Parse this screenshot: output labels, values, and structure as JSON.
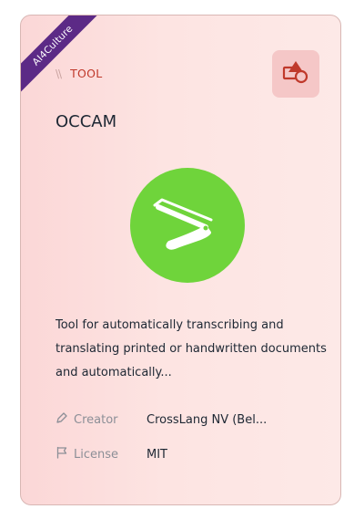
{
  "ribbon": {
    "label": "AI4Culture"
  },
  "category": {
    "separator": "\\\\",
    "label": "TOOL"
  },
  "type_icon": "shapes-icon",
  "title": "OCCAM",
  "logo": {
    "icon": "razor-icon",
    "bg_color": "#6fd43b"
  },
  "description": "Tool for automatically transcribing and translating printed or handwritten documents and automatically...",
  "meta": {
    "creator": {
      "icon": "pen-icon",
      "label": "Creator",
      "value": "CrossLang NV (Bel..."
    },
    "license": {
      "icon": "flag-icon",
      "label": "License",
      "value": "MIT"
    }
  },
  "colors": {
    "accent": "#c0392b",
    "ribbon": "#5c2a86",
    "card_bg": "#fbd7d7"
  }
}
